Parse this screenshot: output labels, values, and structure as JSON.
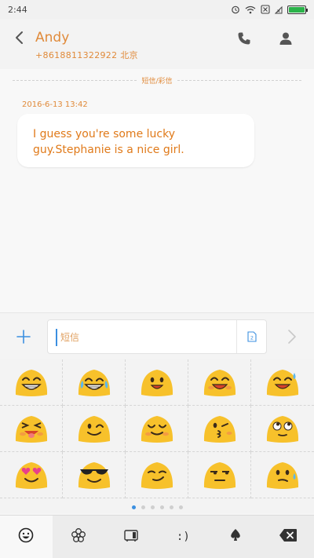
{
  "status_bar": {
    "time": "2:44",
    "battery_level": 1.0
  },
  "header": {
    "contact_name": "Andy",
    "contact_number": "+8618811322922 北京",
    "icons": [
      "back-icon",
      "phone-icon",
      "person-icon"
    ]
  },
  "conversation": {
    "divider_label": "短信/彩信",
    "timestamp": "2016-6-13 13:42",
    "message_text": "I guess you're some lucky guy.Stephanie is a nice girl."
  },
  "composer": {
    "placeholder": "短信",
    "value": "",
    "icons": [
      "plus-icon",
      "sim-icon",
      "send-arrow-icon"
    ]
  },
  "emoji_panel": {
    "emojis": [
      "grinning-blob",
      "tears-of-joy-blob",
      "smiling-blob",
      "laughing-blob",
      "sweat-smile-blob",
      "squinting-tongue-blob",
      "winking-blob",
      "blushing-blob",
      "kissing-wink-blob",
      "eye-roll-blob",
      "heart-eyes-blob",
      "sunglasses-blob",
      "smirking-blob",
      "unamused-blob",
      "confused-sweat-blob"
    ],
    "pages": 6,
    "current_page": 1
  },
  "keyboard_tabs": [
    {
      "name": "emoji-tab",
      "label": "",
      "icon": "emoji-face-icon",
      "active": true
    },
    {
      "name": "flower-tab",
      "label": "",
      "icon": "flower-icon",
      "active": false
    },
    {
      "name": "sticker-tab",
      "label": "",
      "icon": "sticker-icon",
      "active": false
    },
    {
      "name": "emoticon-tab",
      "label": ":)",
      "icon": "",
      "active": false
    },
    {
      "name": "symbol-tab",
      "label": "",
      "icon": "spade-icon",
      "active": false
    },
    {
      "name": "backspace-tab",
      "label": "",
      "icon": "backspace-icon",
      "active": false
    }
  ],
  "colors": {
    "accent_orange": "#e08a3a",
    "accent_blue": "#3b8fe0",
    "emoji_yellow": "#f7c12b"
  }
}
